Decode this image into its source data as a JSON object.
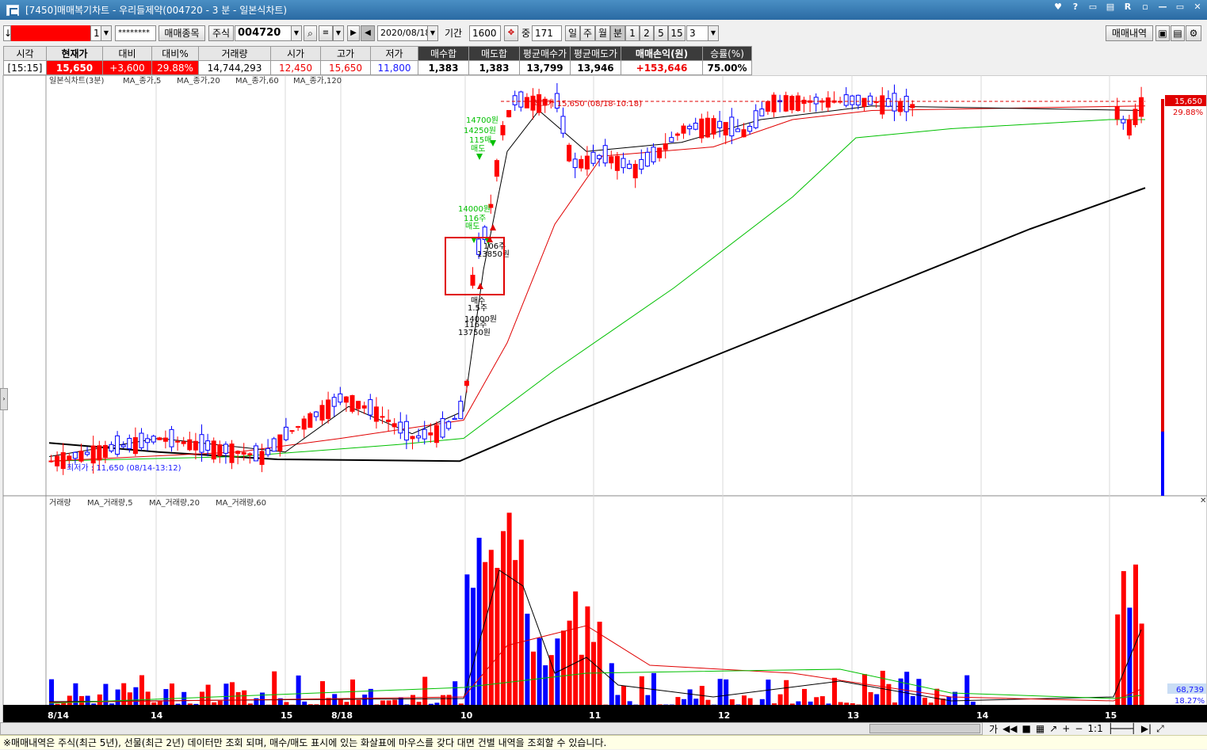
{
  "window": {
    "title": "[7450]매매복기차트 - 우리들제약(004720 - 3 분 - 일본식차트)",
    "controls": [
      "♥",
      "?",
      "▭",
      "▤",
      "R",
      "▫",
      "—",
      "▭",
      "✕"
    ]
  },
  "toolbar": {
    "account_suffix": "1",
    "password": "********",
    "trade_items_label": "매매종목",
    "market": "주식",
    "code": "004720",
    "date": "2020/08/18",
    "period_label": "기간",
    "period_value": "1600",
    "qty_prefix": "중",
    "qty_value": "171",
    "units": [
      "일",
      "주",
      "월",
      "분",
      "1",
      "2",
      "5",
      "15"
    ],
    "unit_value": "3",
    "history_label": "매매내역"
  },
  "info": {
    "headers": [
      "시각",
      "현재가",
      "대비",
      "대비%",
      "거래량",
      "시가",
      "고가",
      "저가",
      "매수합",
      "매도합",
      "평균매수가",
      "평균매도가",
      "매매손익(원)",
      "승률(%)"
    ],
    "values": [
      "[15:15]",
      "15,650",
      "+3,600",
      "29.88%",
      "14,744,293",
      "12,450",
      "15,650",
      "11,800",
      "1,383",
      "1,383",
      "13,799",
      "13,946",
      "+153,646",
      "75.00%"
    ]
  },
  "price_chart": {
    "legend": "일본식차트(3분)",
    "ma_labels": [
      "MA_종가,5",
      "MA_종가,20",
      "MA_종가,60",
      "MA_종가,120"
    ],
    "high_note": "최고가 15,650 (08/18-10:18)",
    "low_note": "최저가 : 11,650 (08/14-13:12)",
    "price_tag": "15,650",
    "pct_tag": "29.88%",
    "marks": [
      {
        "t": "14700원",
        "c": "#00c000"
      },
      {
        "t": "14250원",
        "c": "#00c000"
      },
      {
        "t": "115매",
        "c": "#00c000"
      },
      {
        "t": "매도",
        "c": "#00c000"
      },
      {
        "t": "14000원",
        "c": "#00c000"
      },
      {
        "t": "116주",
        "c": "#00c000"
      },
      {
        "t": "매도",
        "c": "#00c000"
      },
      {
        "t": "106주",
        "c": "#000"
      },
      {
        "t": "13850원",
        "c": "#000"
      },
      {
        "t": "매수",
        "c": "#000"
      },
      {
        "t": "1.5주",
        "c": "#000"
      },
      {
        "t": "14000원",
        "c": "#000"
      },
      {
        "t": "116주",
        "c": "#000"
      },
      {
        "t": "13750원",
        "c": "#000"
      }
    ]
  },
  "volume_chart": {
    "legend": "거래량",
    "ma_labels": [
      "MA_거래량,5",
      "MA_거래량,20",
      "MA_거래량,60"
    ],
    "vol_tag": "68,739",
    "pct_tag": "18.27%"
  },
  "x_axis": [
    "8/14",
    "14",
    "15",
    "8/18",
    "10",
    "11",
    "12",
    "13",
    "14",
    "15"
  ],
  "nav": {
    "ratio": "1:1",
    "ga": "가"
  },
  "footer": "※매매내역은 주식(최근 5년), 선물(최근 2년) 데이터만 조회 되며, 매수/매도 표시에 있는 화살표에 마우스를 갖다 대면 건별 내역을 조회할 수 있습니다.",
  "colors": {
    "up": "#ff0000",
    "down": "#0000ff",
    "ma5": "#000000",
    "ma20": "#e00000",
    "ma60": "#00c000",
    "ma120": "#000000"
  }
}
